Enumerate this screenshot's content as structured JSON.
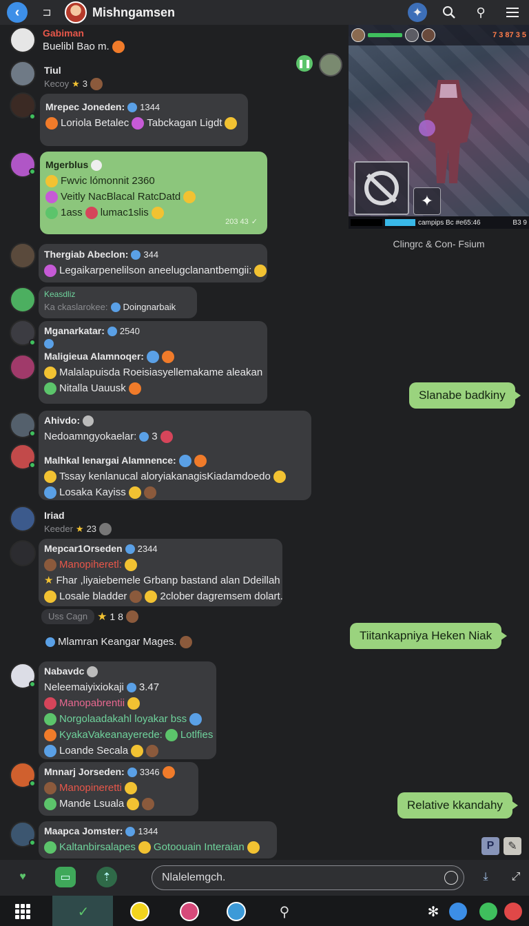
{
  "header": {
    "title": "Mishngamsen"
  },
  "messages": {
    "m1": {
      "name": "Gabiman",
      "text": "Buelibl Bao m."
    },
    "m2": {
      "name": "Tiul",
      "sub": "Kecoy",
      "badge": "3"
    },
    "m3": {
      "name": "Mrepec Joneden:",
      "badge": "1344",
      "line1": "Loriola Betalec",
      "line2": "Tabckagan Ligdt"
    },
    "m4": {
      "name": "Mgerblus",
      "line1": "Fwvic lómonnit 2360",
      "line2": "Veitly NacBlacal RatcDatd",
      "line3": "1ass",
      "line3b": "lumac1slis",
      "time": "203 43"
    },
    "m5": {
      "name": "Thergiab Abeclon:",
      "badge": "344",
      "line1": "Legaikarpenelilson aneelugclanantbemgii:"
    },
    "m6": {
      "name": "Keasdliz",
      "line1": "Ka ckaslarokee:",
      "line1b": "Doingnarbaik"
    },
    "m7": {
      "name": "Mganarkatar:",
      "badge": "2540",
      "line2": "Maligieua Alamnoqer:",
      "line3": "Malalapuisda Roeisiasyellemakame aleakan",
      "line4": "Nitalla Uauusk"
    },
    "m8": {
      "name": "Ahivdo:",
      "line1": "Nedoamngyokaelar:",
      "badge": "3",
      "line2": "Malhkal lenargai Alamnence:",
      "line3": "Tssay kenlanucal aloryiakanagisKiadamdoedo",
      "line4": "Losaka Kayiss"
    },
    "m9": {
      "name": "Iriad",
      "sub": "Keeder",
      "badge": "23"
    },
    "m10": {
      "name": "Mepcar1Orseden",
      "badge": "2344",
      "line1": "Manopiheretl:",
      "line2": "Fhar ,liyaiebemele Grbanp bastand alan Ddeillah",
      "line3": "Losale bladder",
      "line3b": "2clober dagremsem dolart."
    },
    "m11": {
      "sub": "Uss Cagn",
      "badge": "1 8"
    },
    "m12": {
      "text": "Mlamran Keangar Mages."
    },
    "m13": {
      "name": "Nabavdc",
      "line1": "Neleemaiyixiokaji",
      "badge": "3.47",
      "line2": "Manopabrentii",
      "line3": "Norgolaadakahl loyakar bss",
      "line4": "KyakaVakeanayerede:",
      "line4b": "Lotlfies",
      "line5": "Loande Secala"
    },
    "m14": {
      "name": "Mnnarj Jorseden:",
      "badge": "3346",
      "line1": "Manopineretti",
      "line2": "Mande Lsuala"
    },
    "m15": {
      "name": "Maapca Jomster:",
      "badge": "1344",
      "line1": "Kaltanbirsalapes",
      "line1b": "Gotoouain Interaian"
    }
  },
  "outgoing": [
    "Slanabe badkiny",
    "Tiitankapniya Heken Niak",
    "Relative kkandahy"
  ],
  "game": {
    "score": "7 3  87 3 5",
    "hud_bottom": "campips Bc  #e65:46",
    "hud_bottom_right": "B3 9",
    "caption": "Clingrc & Con- Fsium"
  },
  "mini_buttons": [
    "P",
    "✎"
  ],
  "composer": {
    "placeholder": "Nlalelemgch."
  },
  "colors": {
    "accent_blue": "#3d8fe8",
    "bubble_dark": "#3a3b3e",
    "bubble_green": "#8cc67c",
    "online_green": "#3fbf5d"
  }
}
